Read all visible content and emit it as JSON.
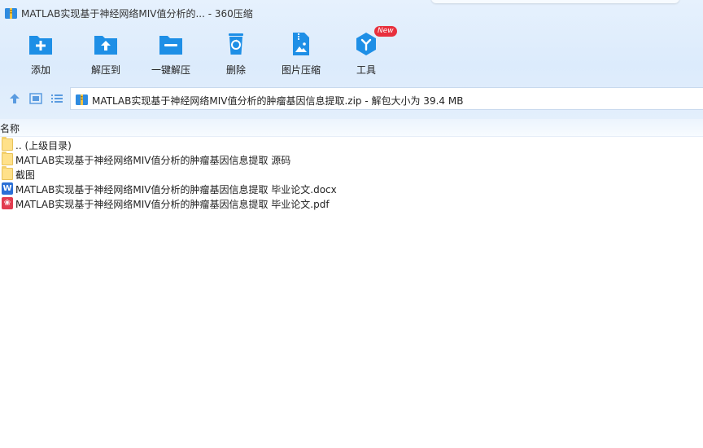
{
  "window": {
    "title": "MATLAB实现基于神经网络MIV值分析的... - 360压缩"
  },
  "toolbar": {
    "add": "添加",
    "extract_to": "解压到",
    "one_click_extract": "一键解压",
    "delete": "删除",
    "image_compress": "图片压缩",
    "tools": "工具",
    "tools_badge": "New"
  },
  "path": {
    "text": "MATLAB实现基于神经网络MIV值分析的肿瘤基因信息提取.zip - 解包大小为 39.4 MB"
  },
  "list": {
    "column_name": "名称",
    "items": [
      {
        "name": ".. (上级目录)",
        "icon": "folder-icon"
      },
      {
        "name": "MATLAB实现基于神经网络MIV值分析的肿瘤基因信息提取 源码",
        "icon": "folder-icon"
      },
      {
        "name": "截图",
        "icon": "folder-icon"
      },
      {
        "name": "MATLAB实现基于神经网络MIV值分析的肿瘤基因信息提取 毕业论文.docx",
        "icon": "word-icon"
      },
      {
        "name": "MATLAB实现基于神经网络MIV值分析的肿瘤基因信息提取 毕业论文.pdf",
        "icon": "pdf-icon"
      }
    ]
  },
  "colors": {
    "accent_blue": "#1e8fe6",
    "band_bg": "#dcebfc",
    "new_badge": "#e8303d"
  }
}
